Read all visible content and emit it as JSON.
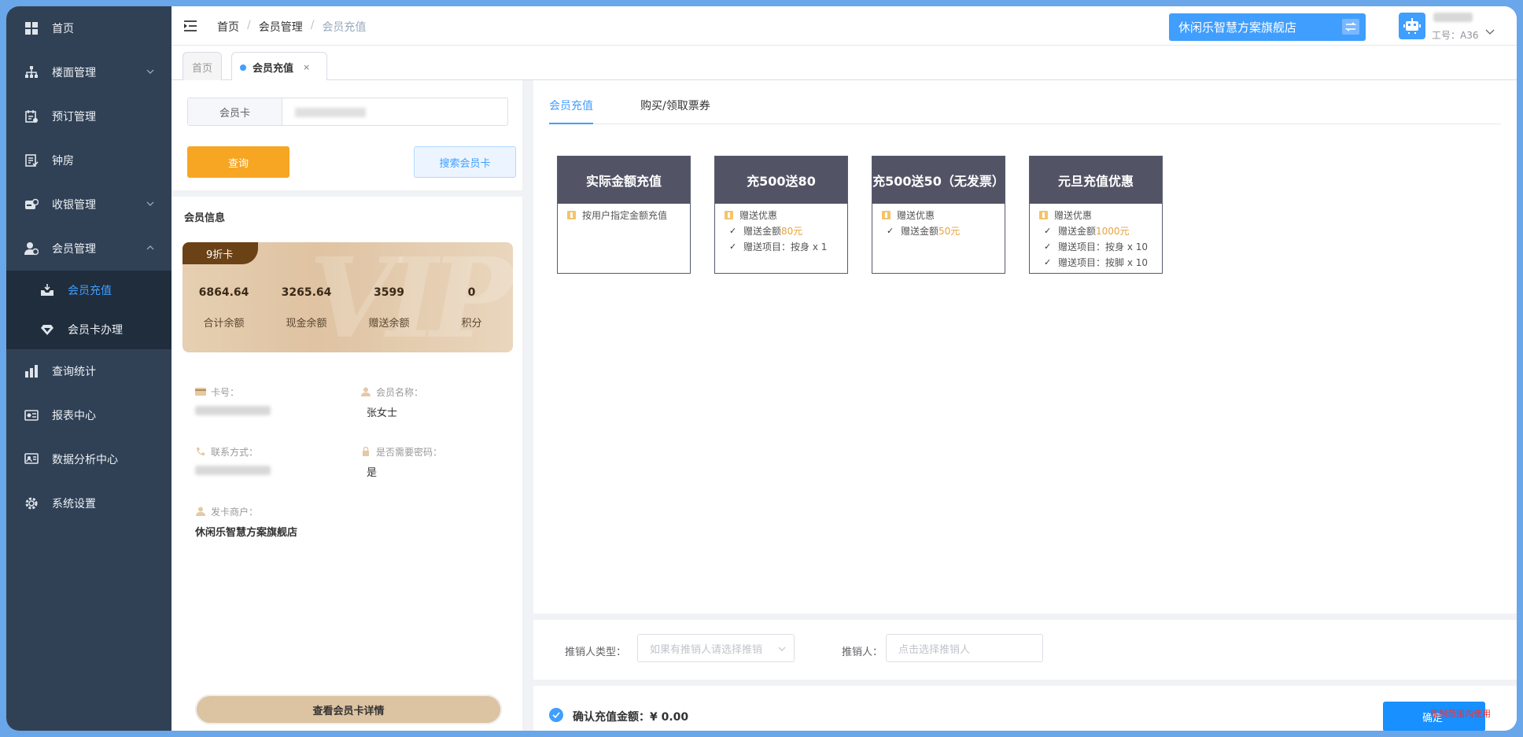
{
  "sidebar": {
    "items": [
      {
        "label": "首页",
        "icon": "dashboard-icon"
      },
      {
        "label": "楼面管理",
        "icon": "sitemap-icon",
        "expandable": true
      },
      {
        "label": "预订管理",
        "icon": "booking-icon"
      },
      {
        "label": "钟房",
        "icon": "clock-room-icon"
      },
      {
        "label": "收银管理",
        "icon": "cashier-icon",
        "expandable": true
      },
      {
        "label": "会员管理",
        "icon": "member-icon",
        "expanded": true
      },
      {
        "label": "查询统计",
        "icon": "stats-icon"
      },
      {
        "label": "报表中心",
        "icon": "report-icon"
      },
      {
        "label": "数据分析中心",
        "icon": "analysis-icon"
      },
      {
        "label": "系统设置",
        "icon": "gear-icon"
      }
    ],
    "submenu": [
      {
        "label": "会员充值",
        "active": true
      },
      {
        "label": "会员卡办理"
      }
    ]
  },
  "header": {
    "breadcrumb": [
      "首页",
      "会员管理",
      "会员充值"
    ],
    "separator": "/",
    "store_name": "休闲乐智慧方案旗舰店",
    "job_no": "工号：A36"
  },
  "tags": {
    "home": "首页",
    "active": "会员充值",
    "close": "×"
  },
  "search": {
    "prefix": "会员卡",
    "query_label": "查询",
    "search_label": "搜索会员卡"
  },
  "member": {
    "section_title": "会员信息",
    "card_level": "9折卡",
    "vip_watermark": "VIP",
    "stats": [
      {
        "value": "6864.64",
        "label": "合计余额"
      },
      {
        "value": "3265.64",
        "label": "现金余额"
      },
      {
        "value": "3599",
        "label": "赠送余额"
      },
      {
        "value": "0",
        "label": "积分"
      }
    ],
    "fields": {
      "card_no_label": "卡号：",
      "name_label": "会员名称：",
      "name_value": "张女士",
      "contact_label": "联系方式：",
      "password_label": "是否需要密码：",
      "password_value": "是",
      "issuer_label": "发卡商户：",
      "issuer_value": "休闲乐智慧方案旗舰店"
    },
    "detail_button": "查看会员卡详情"
  },
  "recharge": {
    "tabs": [
      "会员充值",
      "购买/领取票券"
    ],
    "packages": [
      {
        "title": "实际金额充值",
        "rows": [
          {
            "type": "gift",
            "text": "按用户指定金额充值"
          }
        ]
      },
      {
        "title": "充500送80",
        "rows": [
          {
            "type": "gift",
            "text": "赠送优惠"
          },
          {
            "type": "check",
            "text": "赠送金额 ",
            "gold": "80元"
          },
          {
            "type": "check",
            "text": "赠送项目：按身 x 1"
          }
        ]
      },
      {
        "title": "充500送50（无发票）",
        "rows": [
          {
            "type": "gift",
            "text": "赠送优惠"
          },
          {
            "type": "check",
            "text": "赠送金额 ",
            "gold": "50元"
          }
        ]
      },
      {
        "title": "元旦充值优惠",
        "rows": [
          {
            "type": "gift",
            "text": "赠送优惠"
          },
          {
            "type": "check",
            "text": "赠送金额 ",
            "gold": "1000元"
          },
          {
            "type": "check",
            "text": "赠送项目：按身 x 10"
          },
          {
            "type": "check",
            "text": "赠送项目：按脚 x 10"
          }
        ]
      }
    ]
  },
  "promoter": {
    "type_label": "推销人类型：",
    "type_placeholder": "如果有推销人请选择推销",
    "person_label": "推销人：",
    "person_placeholder": "点击选择推销人"
  },
  "confirm": {
    "text": "确认充值金额：¥ 0.00",
    "button": "确定",
    "watermark": "限制范围内使用"
  },
  "colors": {
    "primary": "#409eff",
    "sidebar": "#304156",
    "query_button": "#f7a623",
    "package_header": "#525466",
    "vip_badge": "#6b4116"
  }
}
